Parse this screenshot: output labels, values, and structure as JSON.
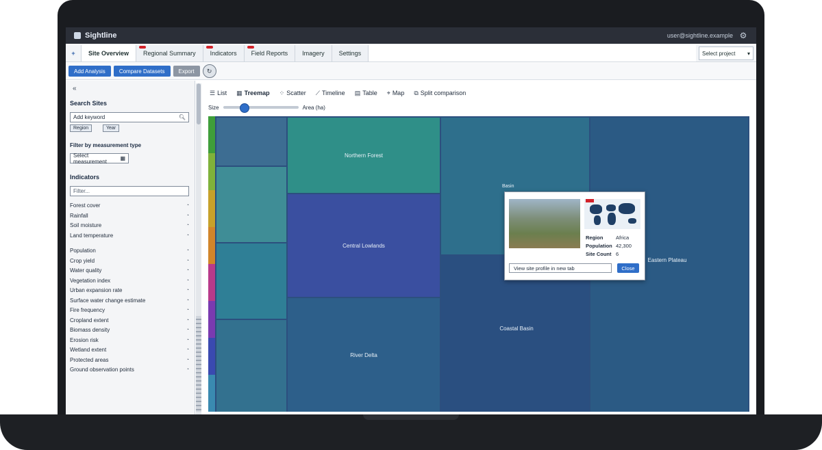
{
  "app": {
    "name": "Sightline",
    "user": "user@sightline.example"
  },
  "tabs": [
    {
      "label": "Site Overview",
      "active": true,
      "alert": false
    },
    {
      "label": "Regional Summary",
      "active": false,
      "alert": true
    },
    {
      "label": "Indicators",
      "active": false,
      "alert": true
    },
    {
      "label": "Field Reports",
      "active": false,
      "alert": true
    },
    {
      "label": "Imagery",
      "active": false,
      "alert": false
    },
    {
      "label": "Settings",
      "active": false,
      "alert": false
    }
  ],
  "project_select": {
    "value": "Select project"
  },
  "actions": {
    "primary": "Add Analysis",
    "secondary": "Compare Datasets",
    "tertiary": "Export"
  },
  "sidebar": {
    "section_search": {
      "title": "Search Sites",
      "input_value": "Add keyword",
      "chips": [
        "Region",
        "Year"
      ]
    },
    "section_filter": {
      "title": "Filter by measurement type",
      "select_value": "Select measurement"
    },
    "section_list": {
      "title": "Indicators",
      "placeholder": "Filter...",
      "items": [
        "Forest cover",
        "Rainfall",
        "Soil moisture",
        "Land temperature",
        "Population",
        "Crop yield",
        "Water quality",
        "Vegetation index",
        "Urban expansion rate",
        "Surface water change estimate",
        "Fire frequency",
        "Cropland extent",
        "Biomass density",
        "Erosion risk",
        "Wetland extent",
        "Protected areas",
        "Ground observation points"
      ]
    }
  },
  "views": [
    {
      "label": "List",
      "icon": "list-icon",
      "active": false
    },
    {
      "label": "Treemap",
      "icon": "treemap-icon",
      "active": true
    },
    {
      "label": "Scatter",
      "icon": "scatter-icon",
      "active": false
    },
    {
      "label": "Timeline",
      "icon": "timeline-icon",
      "active": false
    },
    {
      "label": "Table",
      "icon": "table-icon",
      "active": false
    },
    {
      "label": "Map",
      "icon": "map-icon",
      "active": false
    },
    {
      "label": "Split comparison",
      "icon": "split-icon",
      "active": false
    }
  ],
  "slider": {
    "left_label": "Size",
    "right_label": "Area (ha)",
    "value": 0.28
  },
  "treemap": {
    "cells": [
      {
        "label": ""
      },
      {
        "label": "Northern Forest"
      },
      {
        "label": ""
      },
      {
        "label": ""
      },
      {
        "label": ""
      },
      {
        "label": "Central Lowlands"
      },
      {
        "label": ""
      },
      {
        "label": ""
      },
      {
        "label": "River Delta"
      },
      {
        "label": ""
      },
      {
        "label": "Coastal Basin"
      },
      {
        "label": "Eastern Plateau"
      },
      {
        "label": ""
      }
    ]
  },
  "popup": {
    "pin_label": "Basin",
    "fields": [
      {
        "key": "Region",
        "value": "Africa"
      },
      {
        "key": "Population",
        "value": "42,300"
      },
      {
        "key": "Site Count",
        "value": "6"
      }
    ],
    "open_link": "View site profile in new tab",
    "close_label": "Close"
  },
  "colors": {
    "accent": "#2f6ec8",
    "alert": "#d2222a",
    "legend": [
      "#3f9e3a",
      "#7fb23a",
      "#c7a12a",
      "#d1852a",
      "#b83a8a",
      "#7a3ab0",
      "#3a4ab0",
      "#3a8ab0"
    ]
  }
}
